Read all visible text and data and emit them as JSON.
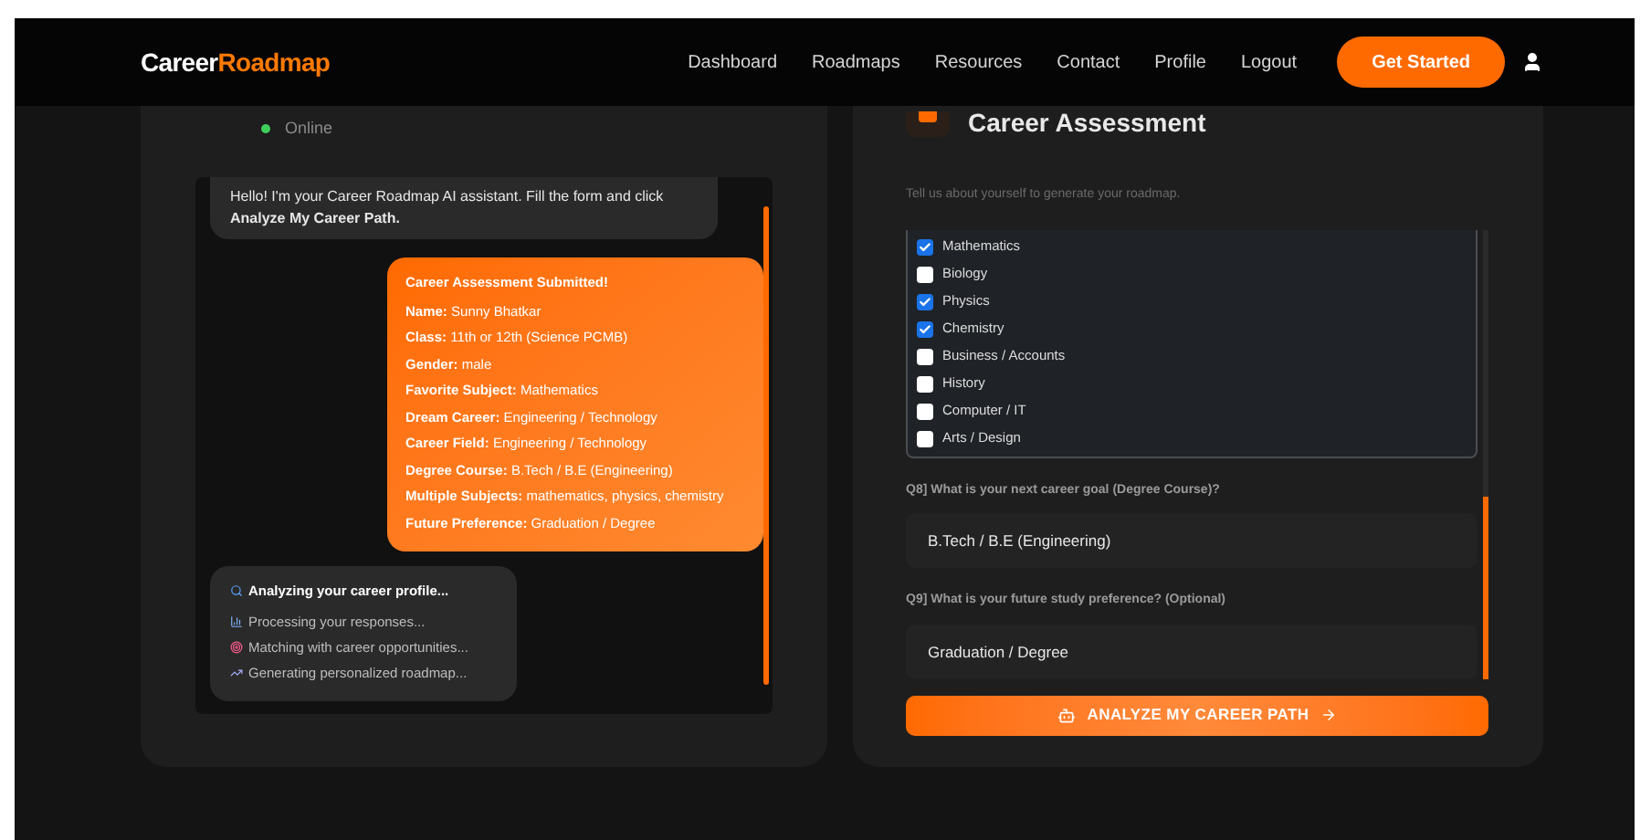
{
  "nav": {
    "logo_left": "Career",
    "logo_right": "Roadmap",
    "links": [
      "Dashboard",
      "Roadmaps",
      "Resources",
      "Contact",
      "Profile",
      "Logout"
    ],
    "cta": "Get Started"
  },
  "chat": {
    "status": "Online",
    "online": true,
    "greeting": "Hello! I'm your Career Roadmap AI assistant. Fill the form and click **Analyze My Career Path.**",
    "submitted": {
      "title": "Career Assessment Submitted!",
      "fields": [
        {
          "label": "Name:",
          "value": "Sunny Bhatkar"
        },
        {
          "label": "Class:",
          "value": "11th or 12th (Science PCMB)"
        },
        {
          "label": "Gender:",
          "value": "male"
        },
        {
          "label": "Favorite Subject:",
          "value": "Mathematics"
        },
        {
          "label": "Dream Career:",
          "value": "Engineering / Technology"
        },
        {
          "label": "Career Field:",
          "value": "Engineering / Technology"
        },
        {
          "label": "Degree Course:",
          "value": "B.Tech / B.E (Engineering)"
        },
        {
          "label": "Multiple Subjects:",
          "value": "mathematics, physics, chemistry"
        },
        {
          "label": "Future Preference:",
          "value": "Graduation / Degree"
        }
      ]
    },
    "analyzing": {
      "title": "Analyzing your career profile...",
      "steps": [
        {
          "kind": "chart",
          "text": "Processing your responses..."
        },
        {
          "kind": "target",
          "text": "Matching with career opportunities..."
        },
        {
          "kind": "trend",
          "text": "Generating personalized roadmap..."
        }
      ]
    }
  },
  "form": {
    "title": "Career Assessment",
    "subtitle": "Tell us about yourself to generate your roadmap.",
    "subjects": [
      {
        "label": "Mathematics",
        "checked": true
      },
      {
        "label": "Biology",
        "checked": false
      },
      {
        "label": "Physics",
        "checked": true
      },
      {
        "label": "Chemistry",
        "checked": true
      },
      {
        "label": "Business / Accounts",
        "checked": false
      },
      {
        "label": "History",
        "checked": false
      },
      {
        "label": "Computer / IT",
        "checked": false
      },
      {
        "label": "Arts / Design",
        "checked": false
      }
    ],
    "questions": [
      {
        "label": "Q8] What is your next career goal (Degree Course)?",
        "value": "B.Tech / B.E (Engineering)"
      },
      {
        "label": "Q9] What is your future study preference? (Optional)",
        "value": "Graduation / Degree"
      }
    ],
    "submit": "ANALYZE MY CAREER PATH"
  }
}
